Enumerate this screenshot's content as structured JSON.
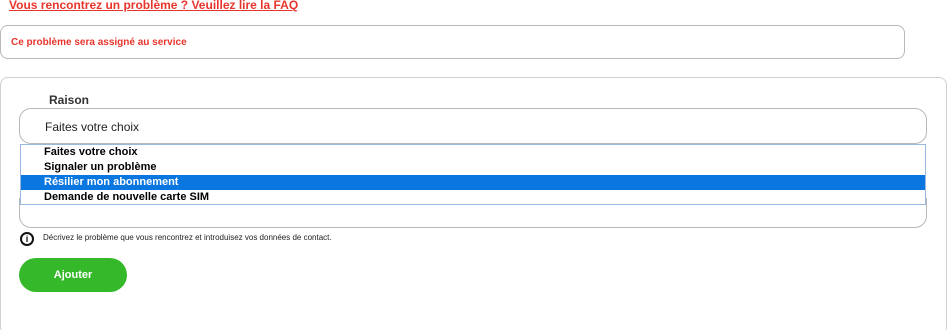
{
  "faq_link": {
    "text": "Vous rencontrez un problème ? Veuillez lire la FAQ"
  },
  "assignment": {
    "text": "Ce problème sera assigné au service"
  },
  "reason": {
    "label": "Raison",
    "selected_value": "Faites votre choix",
    "options": [
      "Faites votre choix",
      "Signaler un problème",
      "Résilier mon abonnement",
      "Demande de nouvelle carte SIM"
    ],
    "highlighted_option": "Résilier mon abonnement"
  },
  "info": {
    "icon": "info-icon",
    "text": "Décrivez le problème que vous rencontrez et introduisez vos données de contact."
  },
  "actions": {
    "add_label": "Ajouter"
  },
  "colors": {
    "link_red": "#e8352c",
    "highlight_blue": "#0a76e0",
    "button_green": "#35b92a"
  }
}
